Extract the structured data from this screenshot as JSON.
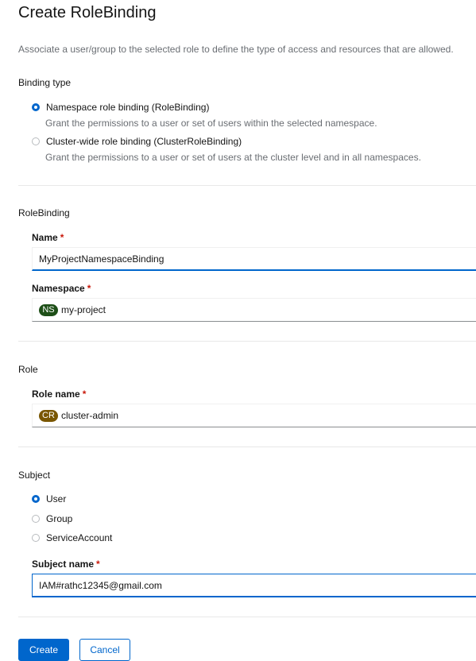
{
  "page": {
    "title": "Create RoleBinding",
    "description": "Associate a user/group to the selected role to define the type of access and resources that are allowed."
  },
  "binding_type": {
    "label": "Binding type",
    "options": [
      {
        "label": "Namespace role binding (RoleBinding)",
        "description": "Grant the permissions to a user or set of users within the selected namespace.",
        "selected": true
      },
      {
        "label": "Cluster-wide role binding (ClusterRoleBinding)",
        "description": "Grant the permissions to a user or set of users at the cluster level and in all namespaces.",
        "selected": false
      }
    ]
  },
  "rolebinding": {
    "label": "RoleBinding",
    "name_label": "Name",
    "name_value": "MyProjectNamespaceBinding",
    "namespace_label": "Namespace",
    "namespace_badge": "NS",
    "namespace_value": "my-project"
  },
  "role": {
    "label": "Role",
    "role_name_label": "Role name",
    "role_badge": "CR",
    "role_value": "cluster-admin"
  },
  "subject": {
    "label": "Subject",
    "options": [
      {
        "label": "User",
        "selected": true
      },
      {
        "label": "Group",
        "selected": false
      },
      {
        "label": "ServiceAccount",
        "selected": false
      }
    ],
    "subject_name_label": "Subject name",
    "subject_name_value": "IAM#rathc12345@gmail.com"
  },
  "required_marker": "*",
  "actions": {
    "create_label": "Create",
    "cancel_label": "Cancel"
  },
  "colors": {
    "primary": "#0066cc",
    "required": "#c9190b",
    "ns_badge": "#1e4f18",
    "cr_badge": "#795600"
  }
}
